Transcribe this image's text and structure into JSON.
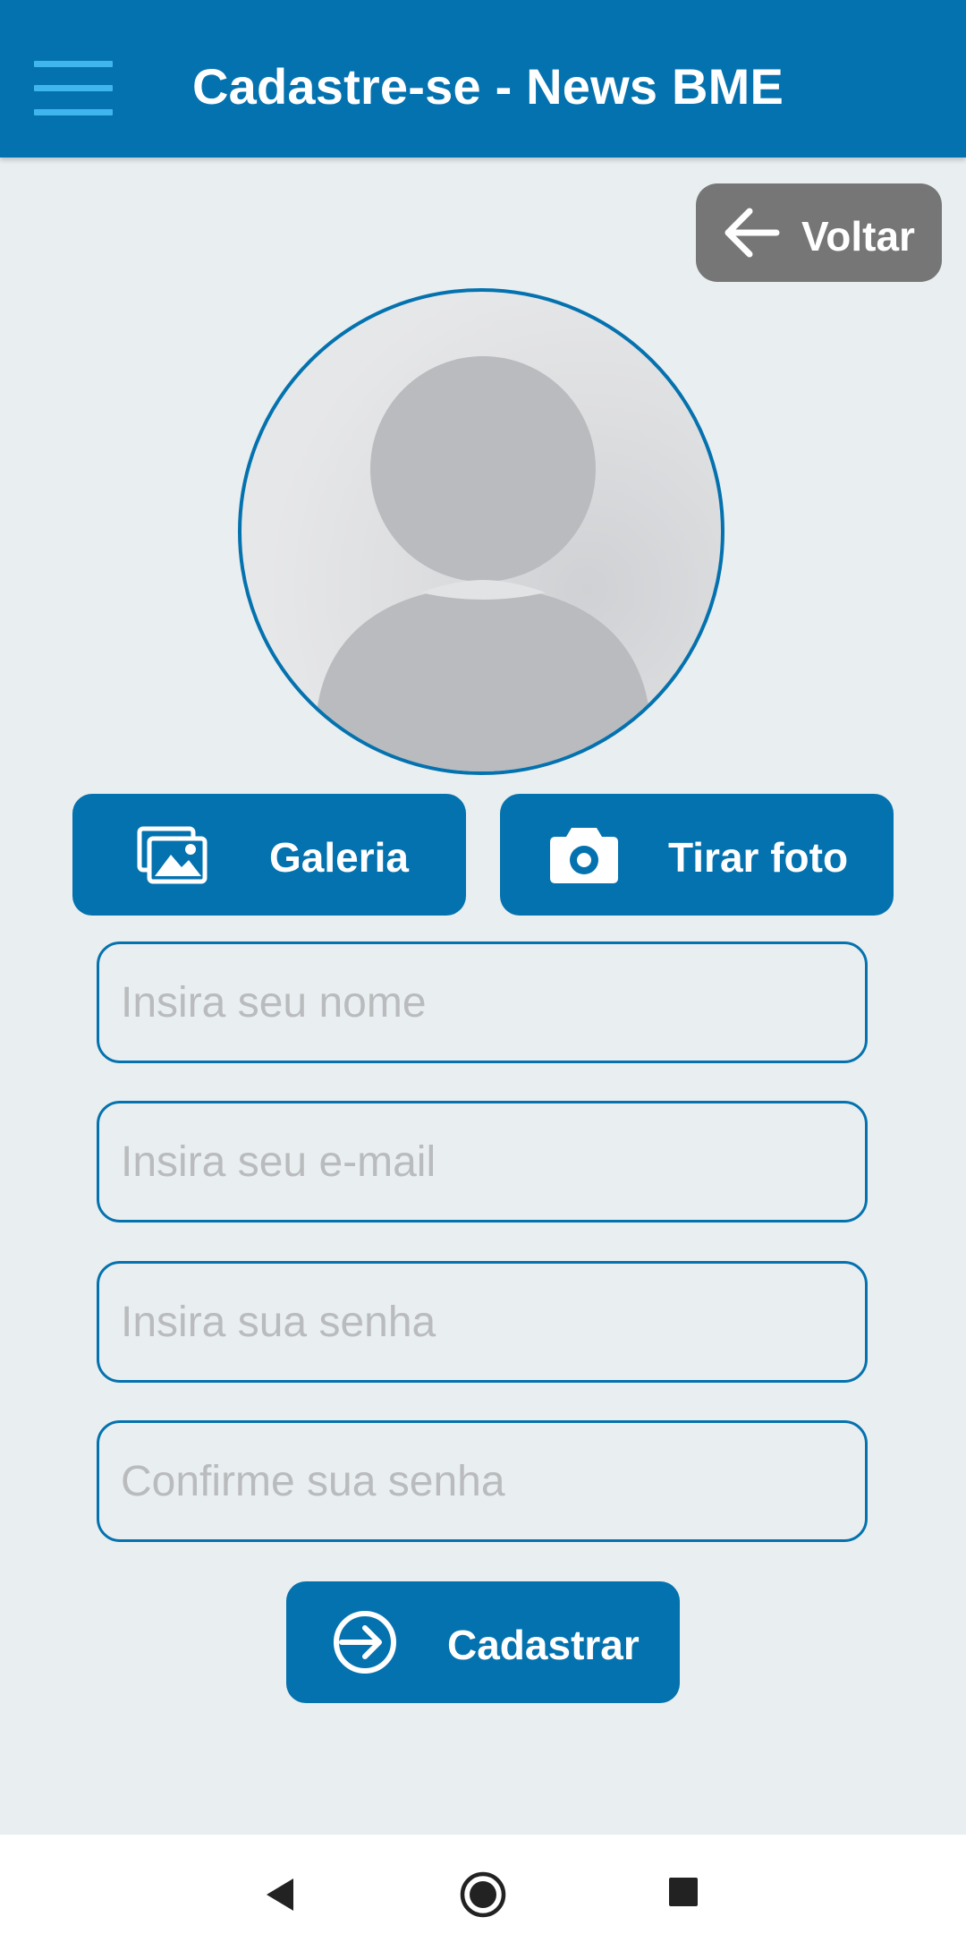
{
  "appbar": {
    "title": "Cadastre-se - News BME",
    "menu_icon": "hamburger-menu-icon",
    "color": "#0472AE",
    "menu_icon_color": "#3FB6EE"
  },
  "back_button": {
    "label": "Voltar",
    "icon": "arrow-left-icon",
    "color": "#767676"
  },
  "avatar": {
    "icon": "user-placeholder-icon"
  },
  "photo_buttons": {
    "gallery": {
      "label": "Galeria",
      "icon": "images-icon"
    },
    "camera": {
      "label": "Tirar foto",
      "icon": "camera-icon"
    }
  },
  "form": {
    "name_placeholder": "Insira seu nome",
    "email_placeholder": "Insira seu e-mail",
    "password_placeholder": "Insira sua senha",
    "confirm_password_placeholder": "Confirme sua senha"
  },
  "submit_button": {
    "label": "Cadastrar",
    "icon": "sign-in-icon"
  },
  "system_nav": {
    "back": "nav-back-icon",
    "home": "nav-home-icon",
    "recents": "nav-recents-icon"
  },
  "colors": {
    "primary": "#0472AE",
    "background": "#E9EEF1",
    "placeholder": "#B9BBBD"
  }
}
